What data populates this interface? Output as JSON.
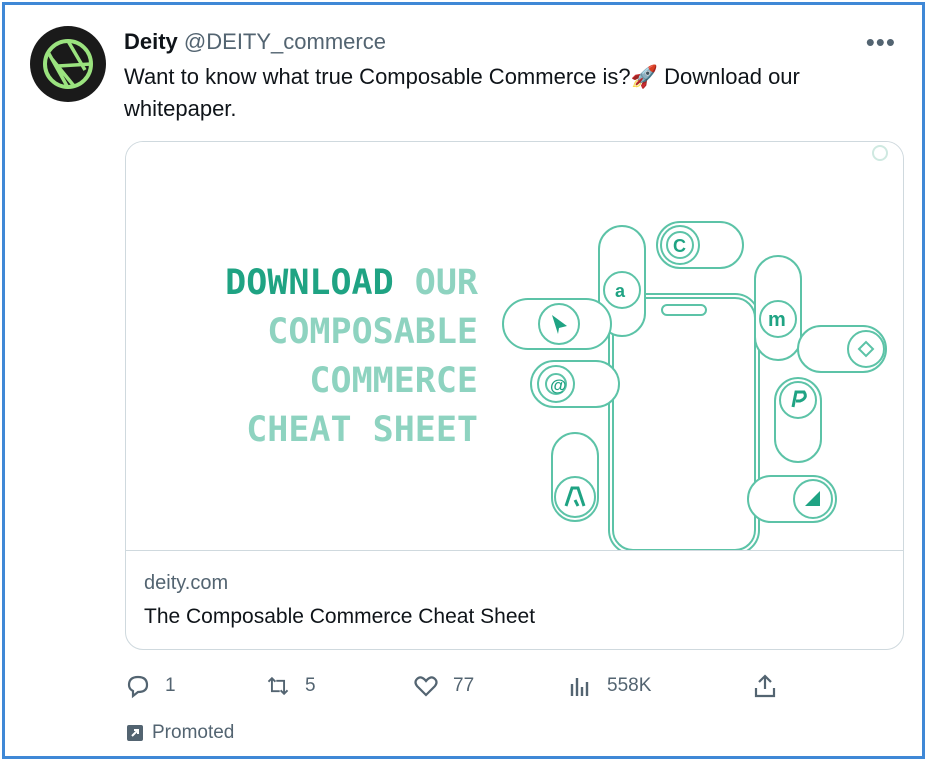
{
  "tweet": {
    "author_name": "Deity",
    "author_handle": "@DEITY_commerce",
    "text": "Want to know what true Composable Commerce is?🚀 Download our whitepaper.",
    "more_label": "•••"
  },
  "card": {
    "headline": {
      "line1_a": "DOWNLOAD",
      "line1_b": " OUR",
      "line2": "COMPOSABLE",
      "line3": "COMMERCE",
      "line4": "CHEAT SHEET"
    },
    "domain": "deity.com",
    "title": "The Composable Commerce Cheat Sheet"
  },
  "actions": {
    "replies": "1",
    "retweets": "5",
    "likes": "77",
    "views": "558K"
  },
  "promoted_label": "Promoted",
  "colors": {
    "accent_teal": "#1fa383",
    "light_teal": "#8ed3c0",
    "border": "#3f88d6"
  }
}
